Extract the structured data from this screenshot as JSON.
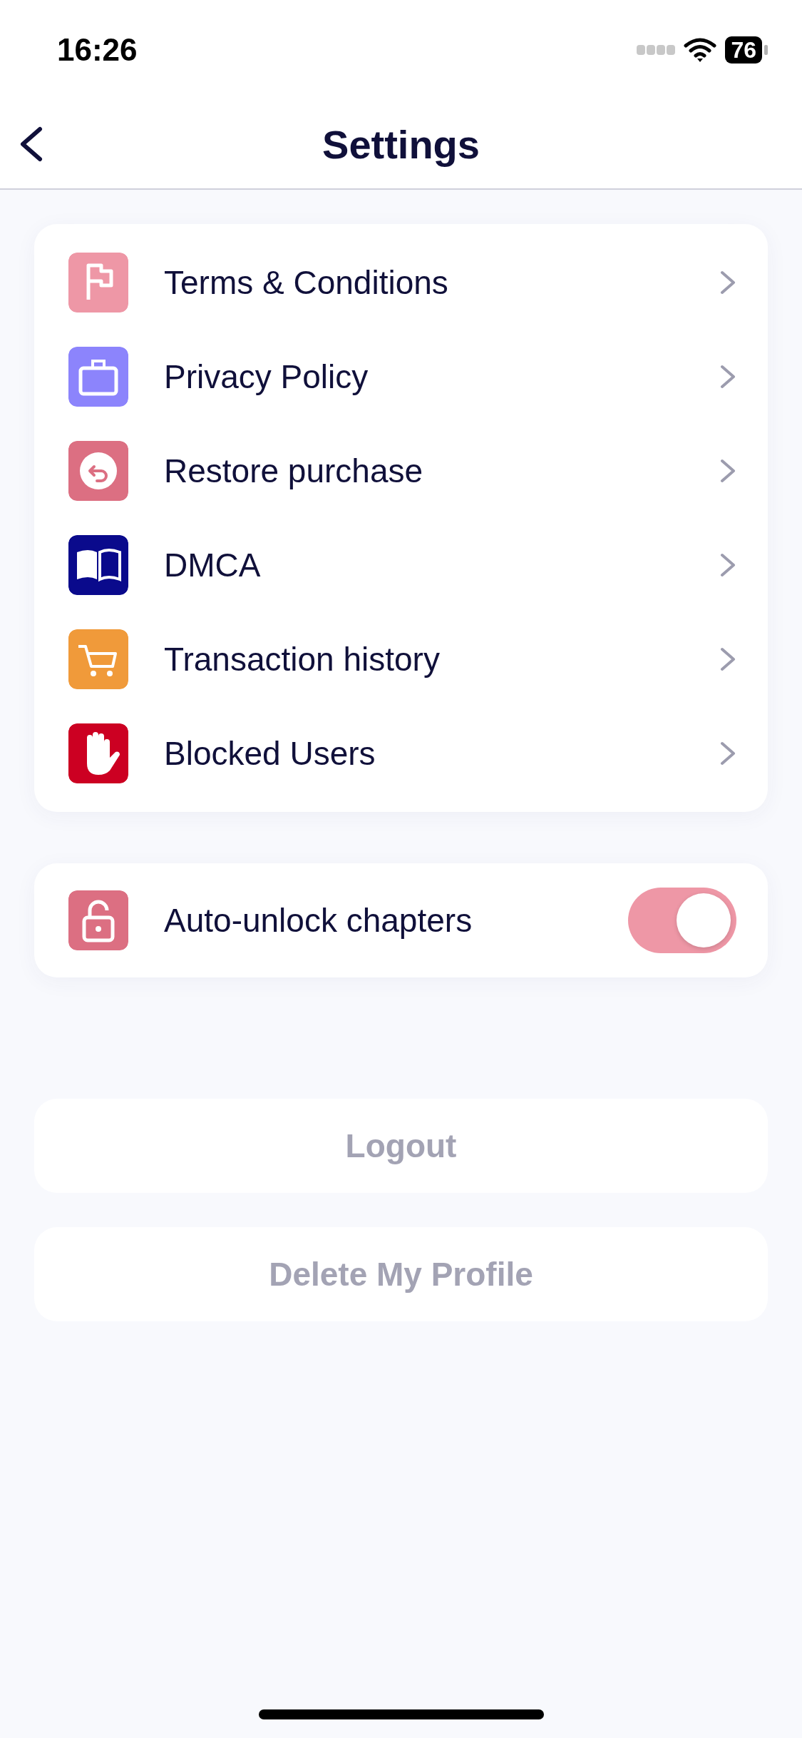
{
  "status_bar": {
    "time": "16:26",
    "battery": "76"
  },
  "nav": {
    "title": "Settings"
  },
  "menu": [
    {
      "label": "Terms & Conditions",
      "color": "#ee97a6"
    },
    {
      "label": "Privacy Policy",
      "color": "#8c84fc"
    },
    {
      "label": "Restore purchase",
      "color": "#dc6f82"
    },
    {
      "label": "DMCA",
      "color": "#0a0a8c"
    },
    {
      "label": "Transaction history",
      "color": "#f09a3a"
    },
    {
      "label": "Blocked Users",
      "color": "#cc0022"
    }
  ],
  "toggle": {
    "label": "Auto-unlock chapters",
    "color": "#dc6f82",
    "on": true
  },
  "buttons": [
    "Logout",
    "Delete My Profile"
  ]
}
